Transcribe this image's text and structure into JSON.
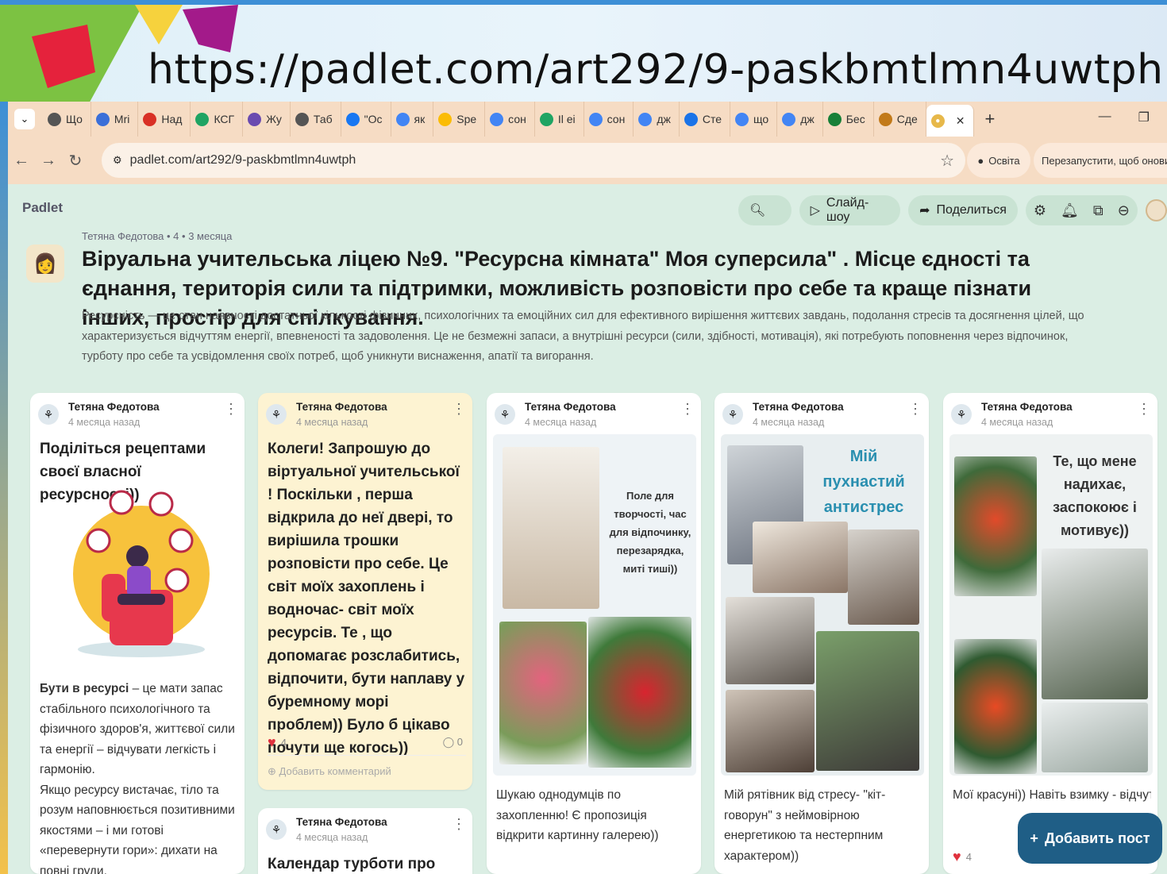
{
  "slide": {
    "url_title": "https://padlet.com/art292/9-paskbmtlmn4uwtph"
  },
  "browser": {
    "tabs": [
      {
        "label": "Що",
        "icon": "globe-icon",
        "color": "#555"
      },
      {
        "label": "Mri",
        "icon": "app-icon",
        "color": "#3b6fd8"
      },
      {
        "label": "Над",
        "icon": "gmail-icon",
        "color": "#d93025"
      },
      {
        "label": "КСГ",
        "icon": "drive-icon",
        "color": "#1fa463"
      },
      {
        "label": "Жу",
        "icon": "app-icon",
        "color": "#6a4bb0"
      },
      {
        "label": "Таб",
        "icon": "globe-icon",
        "color": "#555"
      },
      {
        "label": "\"Ос",
        "icon": "facebook-icon",
        "color": "#1877f2"
      },
      {
        "label": "як",
        "icon": "google-icon",
        "color": "#4285f4"
      },
      {
        "label": "Spe",
        "icon": "drive-icon",
        "color": "#fbbc04"
      },
      {
        "label": "сон",
        "icon": "google-icon",
        "color": "#4285f4"
      },
      {
        "label": "Il еі",
        "icon": "drive-icon",
        "color": "#1fa463"
      },
      {
        "label": "сон",
        "icon": "google-icon",
        "color": "#4285f4"
      },
      {
        "label": "дж",
        "icon": "google-icon",
        "color": "#4285f4"
      },
      {
        "label": "Сте",
        "icon": "star-icon",
        "color": "#1a73e8"
      },
      {
        "label": "що",
        "icon": "google-icon",
        "color": "#4285f4"
      },
      {
        "label": "дж",
        "icon": "google-icon",
        "color": "#4285f4"
      },
      {
        "label": "Бес",
        "icon": "app-icon",
        "color": "#188038"
      },
      {
        "label": "Сде",
        "icon": "app-icon",
        "color": "#c27a1a"
      }
    ],
    "active_tab_close": "✕",
    "new_tab": "+",
    "address": "padlet.com/art292/9-paskbmtlmn4uwtph",
    "profile_label": "Освіта",
    "relaunch_label": "Перезапустити, щоб оновити"
  },
  "padlet": {
    "logo": "Padlet",
    "slideshow": "Слайд-шоу",
    "share": "Поделиться",
    "meta": "Тетяна Федотова • 4 • 3 месяца",
    "title": "Віруальна учительська ліцею №9. \"Ресурсна кімната\" Моя суперсила\" .  Місце єдності та єднання, територія сили та підтримки, можливість розповісти про себе та краще  пізнати інших, простір для спілкування.",
    "description": "Ресурсність — це стан наявності достатньої кількості фізичних, психологічних та емоційних сил для ефективного вирішення життєвих завдань, подолання стресів та досягнення цілей, що характеризується відчуттям енергії, впевненості та задоволення. Це не безмежні запаси, а внутрішні ресурси (сили, здібності, мотивація), які потребують поповнення через відпочинок, турботу про себе та усвідомлення своїх потреб, щоб уникнути виснаження, апатії та вигорання.",
    "add_post": "Добавить пост"
  },
  "posts": [
    {
      "author": "Тетяна Федотова",
      "time": "4 месяца назад",
      "title": "Поділіться рецептами своєї власної ресурсності))",
      "text_bold": "Бути в ресурсі",
      "text": " – це мати запас стабільного психологічного та фізичного здоров'я, життєвої сили та енергії – відчувати легкість і гармонію.\nЯкщо ресурсу вистачає, тіло та розум наповнюється позитивними якостями – і ми готові «перевернути гори»: дихати на повні груди,"
    },
    {
      "author": "Тетяна Федотова",
      "time": "4 месяца назад",
      "title": "Колеги! Запрошую до віртуальної учительської ! Поскільки , перша відкрила до неї двері, то вирішила трошки розповісти про себе. Це світ моїх захоплень і водночас- світ моїх ресурсів. Те , що допомагає розслабитись, відпочити, бути наплаву у буремному морі проблем)) Було б цікаво почути ще когось))",
      "likes": "4",
      "comments": "0",
      "add_comment": "Добавить комментарий"
    },
    {
      "author": "Тетяна Федотова",
      "time": "4 месяца назад",
      "title": "Календар турботи про себе –"
    },
    {
      "author": "Тетяна Федотова",
      "time": "4 месяца назад",
      "image_caption": "Поле для творчості, час для відпочинку, перезарядка, миті тиші))",
      "text": "Шукаю однодумців по захопленню! Є пропозиція відкрити картинну галерею))"
    },
    {
      "author": "Тетяна Федотова",
      "time": "4 месяца назад",
      "image_caption": "Мій пухнастий антистрес",
      "text": "Мій рятівник від стресу- \"кіт-говорун\"  з неймовірною енергетикою та нестерпним характером))"
    },
    {
      "author": "Тетяна Федотова",
      "time": "4 месяца назад",
      "image_caption": "Те, що мене надихає, заспокоює і мотивує))",
      "text": "Мої красуні)) Навіть взимку - відчуття весн",
      "likes": "4"
    }
  ],
  "colors": {
    "accent": "#1f5e86",
    "board_bg": "#dfeee6",
    "tabbar": "#f6dcc4",
    "heart": "#e0323e"
  }
}
